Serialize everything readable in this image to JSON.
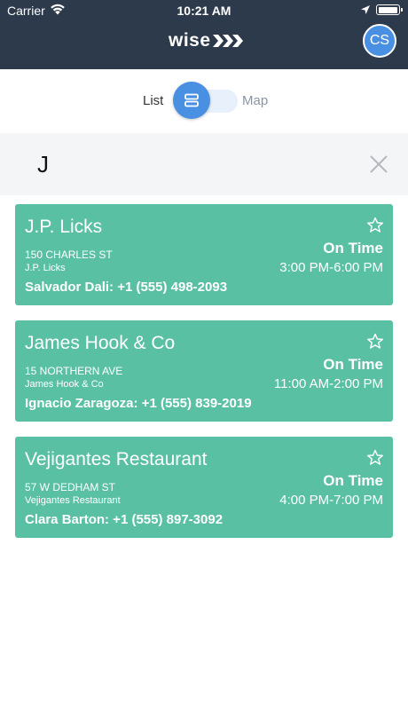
{
  "status_bar": {
    "carrier": "Carrier",
    "time": "10:21 AM"
  },
  "header": {
    "logo_text": "wise",
    "avatar_initials": "CS",
    "bg_color": "#2d3a4c",
    "accent_color": "#4a90e2"
  },
  "view_toggle": {
    "list_label": "List",
    "map_label": "Map",
    "selected": "List"
  },
  "search": {
    "value": "J"
  },
  "card_color": "#5ac0a4",
  "results": [
    {
      "name": "J.P. Licks",
      "address": "150 CHARLES ST",
      "business": "J.P. Licks",
      "contact": "Salvador Dali: +1 (555) 498-2093",
      "status": "On Time",
      "window": "3:00 PM-6:00 PM"
    },
    {
      "name": "James Hook & Co",
      "address": "15 NORTHERN AVE",
      "business": "James Hook & Co",
      "contact": "Ignacio Zaragoza: +1 (555) 839-2019",
      "status": "On Time",
      "window": "11:00 AM-2:00 PM"
    },
    {
      "name": "Vejigantes Restaurant",
      "address": "57 W DEDHAM ST",
      "business": "Vejigantes Restaurant",
      "contact": "Clara Barton: +1 (555) 897-3092",
      "status": "On Time",
      "window": "4:00 PM-7:00 PM"
    }
  ]
}
